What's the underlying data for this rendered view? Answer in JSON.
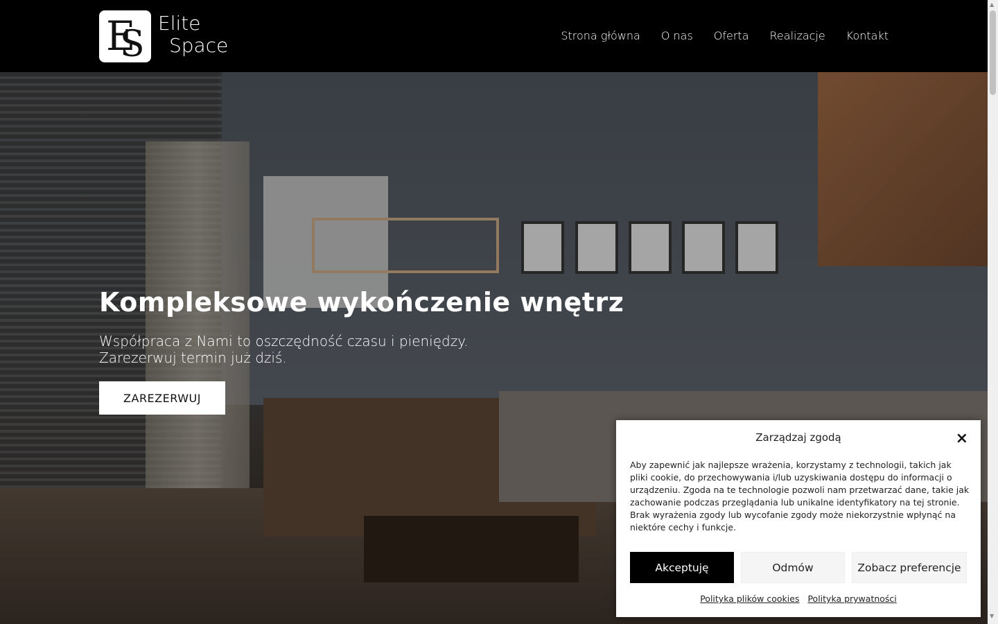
{
  "header": {
    "logo_letters": "ES",
    "logo_line1": "Elite",
    "logo_line2": "Space",
    "nav": [
      "Strona główna",
      "O nas",
      "Oferta",
      "Realizacje",
      "Kontakt"
    ]
  },
  "hero": {
    "title": "Kompleksowe wykończenie wnętrz",
    "subtitle_line1": "Współpraca z Nami to oszczędność czasu i pieniędzy.",
    "subtitle_line2": "Zarezerwuj termin już dziś.",
    "button": "ZAREZERWUJ"
  },
  "consent": {
    "title": "Zarządzaj zgodą",
    "close_icon": "×",
    "text": "Aby zapewnić jak najlepsze wrażenia, korzystamy z technologii, takich jak pliki cookie, do przechowywania i/lub uzyskiwania dostępu do informacji o urządzeniu. Zgoda na te technologie pozwoli nam przetwarzać dane, takie jak zachowanie podczas przeglądania lub unikalne identyfikatory na tej stronie. Brak wyrażenia zgody lub wycofanie zgody może niekorzystnie wpłynąć na niektóre cechy i funkcje.",
    "accept": "Akceptuję",
    "deny": "Odmów",
    "preferences": "Zobacz preferencje",
    "link_cookies": "Polityka plików cookies",
    "link_privacy": "Polityka prywatności"
  },
  "colors": {
    "header_bg": "#000000",
    "accent": "#000000",
    "button_bg": "#ffffff"
  }
}
